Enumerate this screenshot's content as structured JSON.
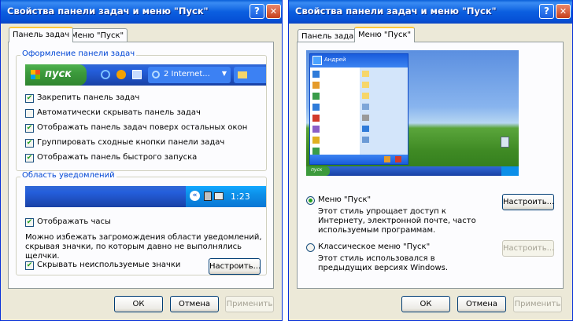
{
  "left_window": {
    "title": "Свойства панели задач и меню \"Пуск\"",
    "help_btn": "?",
    "close_btn": "✕",
    "tabs": [
      "Панель задач",
      "Меню \"Пуск\""
    ],
    "taskbar_group": {
      "label": "Оформление панели задач",
      "preview": {
        "start_label": "пуск",
        "task_label": "2 Internet...",
        "quicklaunch": [
          "ie-icon",
          "media-icon",
          "desktop-icon"
        ]
      },
      "options": [
        {
          "label": "Закрепить панель задач",
          "checked": true
        },
        {
          "label": "Автоматически скрывать панель задач",
          "checked": false
        },
        {
          "label": "Отображать панель задач поверх остальных окон",
          "checked": true
        },
        {
          "label": "Группировать сходные кнопки панели задач",
          "checked": true
        },
        {
          "label": "Отображать панель быстрого запуска",
          "checked": true
        }
      ]
    },
    "notify_group": {
      "label": "Область уведомлений",
      "clock": "1:23",
      "show_clock": {
        "label": "Отображать часы",
        "checked": true
      },
      "description": "Можно избежать загромождения области уведомлений, скрывая значки, по которым давно не выполнялись щелчки.",
      "hide_icons": {
        "label": "Скрывать неиспользуемые значки",
        "checked": true
      },
      "customize_btn": "Настроить..."
    },
    "buttons": {
      "ok": "ОК",
      "cancel": "Отмена",
      "apply": "Применить"
    }
  },
  "right_window": {
    "title": "Свойства панели задач и меню \"Пуск\"",
    "help_btn": "?",
    "close_btn": "✕",
    "tabs": [
      "Панель задач",
      "Меню \"Пуск\""
    ],
    "preview": {
      "user": "Андрей",
      "start_label": "пуск"
    },
    "start_menu": {
      "label": "Меню \"Пуск\"",
      "selected": true,
      "description": "Этот стиль упрощает доступ к Интернету, электронной почте, часто используемым программам.",
      "customize_btn": "Настроить..."
    },
    "classic_menu": {
      "label": "Классическое меню \"Пуск\"",
      "selected": false,
      "description": "Этот стиль использовался в предыдущих версиях Windows.",
      "customize_btn": "Настроить..."
    },
    "buttons": {
      "ok": "ОК",
      "cancel": "Отмена",
      "apply": "Применить"
    }
  }
}
